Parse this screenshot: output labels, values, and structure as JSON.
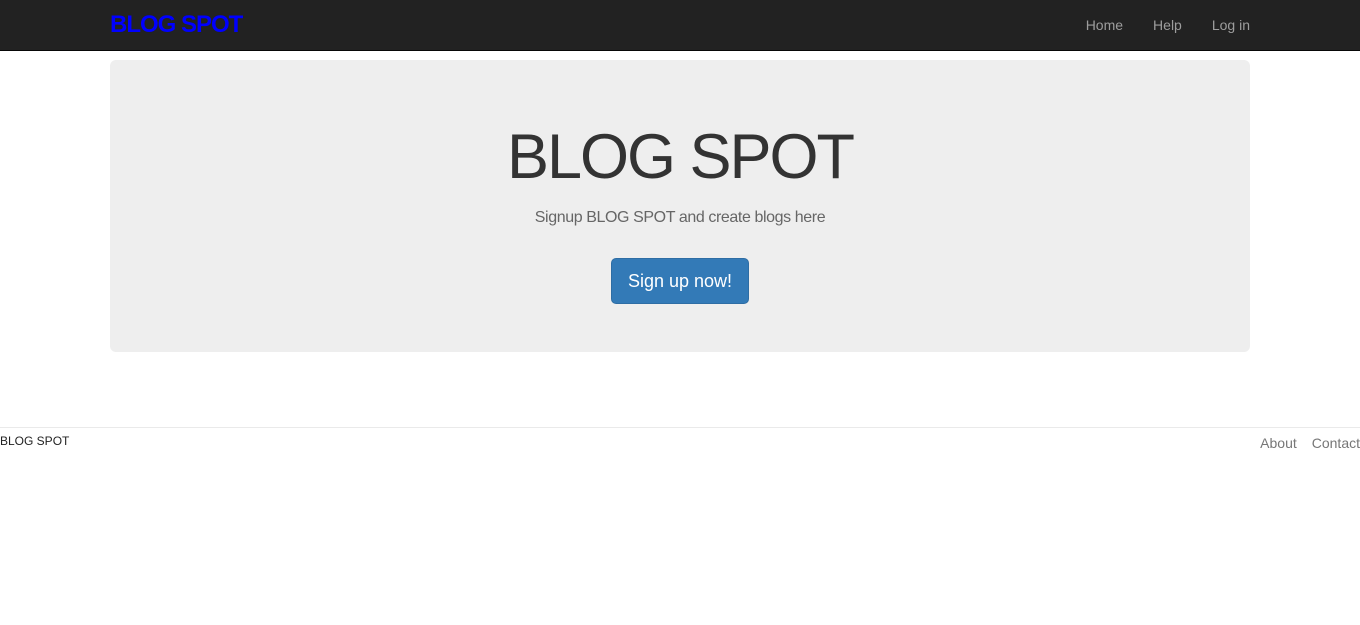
{
  "colors": {
    "navbar_bg": "#222222",
    "brand": "#0000ff",
    "nav_link": "#9d9d9d",
    "jumbotron_bg": "#eeeeee",
    "primary_button": "#337ab7"
  },
  "header": {
    "brand": "BLOG SPOT",
    "nav": [
      {
        "label": "Home"
      },
      {
        "label": "Help"
      },
      {
        "label": "Log in"
      }
    ]
  },
  "hero": {
    "title": "BLOG SPOT",
    "subtitle": "Signup BLOG SPOT and create blogs here",
    "button_label": "Sign up now!"
  },
  "footer": {
    "brand": "BLOG SPOT",
    "links": [
      {
        "label": "About"
      },
      {
        "label": "Contact"
      }
    ]
  }
}
